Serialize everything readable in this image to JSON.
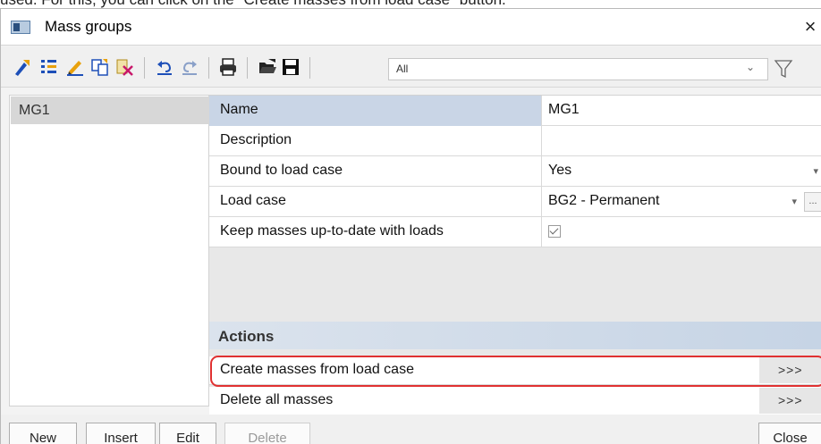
{
  "caption": "used. For this, you can click on the \"Create masses from load case\" button.",
  "window": {
    "title": "Mass groups",
    "close": "×"
  },
  "toolbar": {
    "icons": [
      "new-item-icon",
      "insert-icon",
      "edit-icon",
      "copy-icon",
      "delete-icon",
      "undo-icon",
      "redo-icon",
      "print-icon",
      "open-folder-icon",
      "save-icon",
      "filter-funnel-icon"
    ],
    "filter_value": "All",
    "filter_arrow": "⌄"
  },
  "list": {
    "items": [
      "MG1"
    ]
  },
  "properties": {
    "rows": [
      {
        "name": "Name",
        "value": "MG1"
      },
      {
        "name": "Description",
        "value": ""
      },
      {
        "name": "Bound to load case",
        "value": "Yes"
      },
      {
        "name": "Load case",
        "value": "BG2 - Permanent"
      },
      {
        "name": "Keep masses up-to-date with loads",
        "value": ""
      }
    ],
    "ellipsis": "...",
    "keep_up_to_date_checked": true
  },
  "actions": {
    "header": "Actions",
    "items": [
      {
        "label": "Create masses from load case",
        "button": ">>>"
      },
      {
        "label": "Delete all masses",
        "button": ">>>"
      }
    ]
  },
  "buttons": {
    "new": "New",
    "insert": "Insert",
    "edit": "Edit",
    "delete": "Delete",
    "close": "Close"
  },
  "colors": {
    "highlight": "#e03131",
    "selected_row": "#c9d5e6",
    "actions_header": "#c6d4e5"
  }
}
